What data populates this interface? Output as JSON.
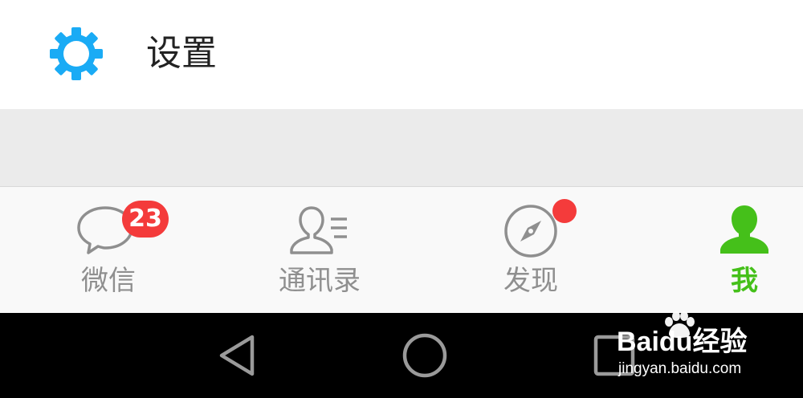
{
  "settings": {
    "label": "设置",
    "icon": "gear-icon",
    "icon_color": "#1aabf5"
  },
  "tabbar": {
    "tabs": [
      {
        "label": "微信",
        "icon": "chat-bubble-icon",
        "badge": "23",
        "active": false
      },
      {
        "label": "通讯录",
        "icon": "contacts-icon",
        "active": false
      },
      {
        "label": "发现",
        "icon": "compass-icon",
        "has_dot": true,
        "active": false
      },
      {
        "label": "我",
        "icon": "person-icon",
        "active": true
      }
    ],
    "active_color": "#45c01a",
    "inactive_color": "#8f8f8f",
    "badge_color": "#f43b3b"
  },
  "navbar": {
    "buttons": [
      "back-icon",
      "home-icon",
      "recents-icon"
    ]
  },
  "watermark": {
    "brand": "Baidu经验",
    "url": "jingyan.baidu.com"
  }
}
